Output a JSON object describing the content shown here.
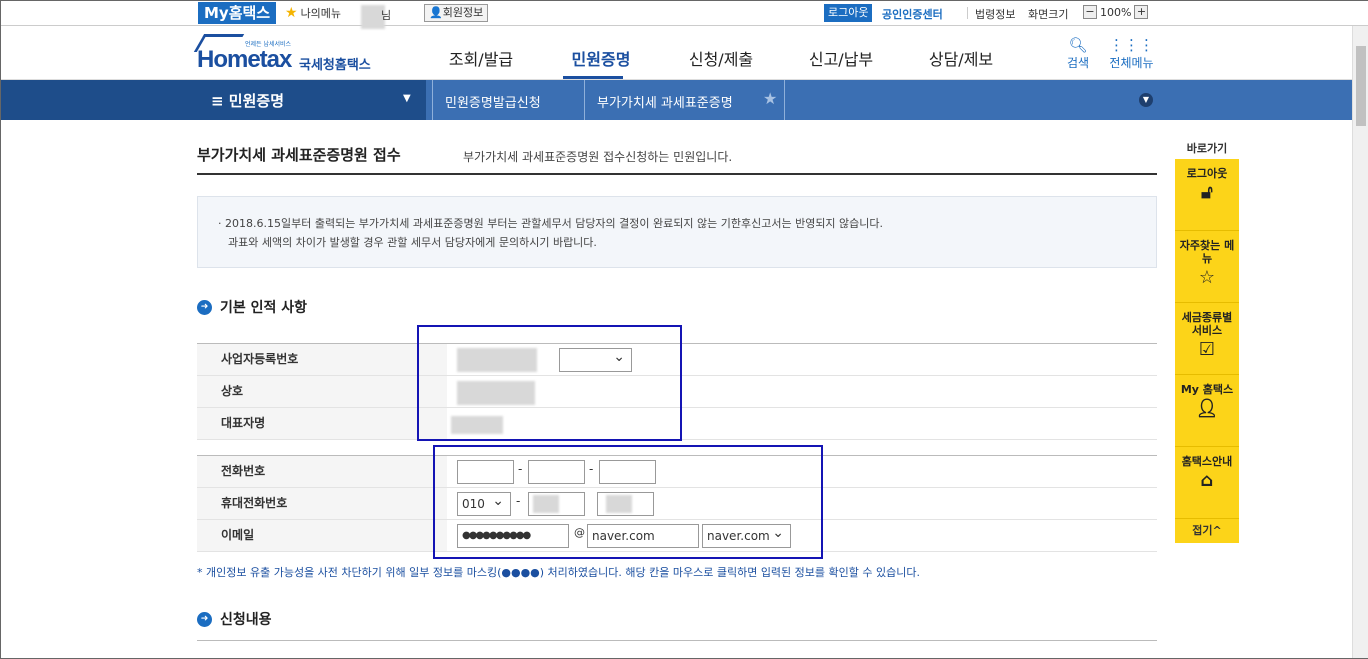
{
  "topbar": {
    "my_hometax": "My홈택스",
    "my_menu": "나의메뉴",
    "nim": "님",
    "member_info": "회원정보",
    "logout": "로그아웃",
    "cert_center": "공인인증센터",
    "law_info": "법령정보",
    "screen_size": "화면크기",
    "zoom_minus": "−",
    "zoom_level": "100%",
    "zoom_plus": "+"
  },
  "logo": {
    "tagline": "언제든 납세서비스",
    "home": "Hometax",
    "korean": "국세청홈택스"
  },
  "gnb": [
    "조회/발급",
    "민원증명",
    "신청/제출",
    "신고/납부",
    "상담/제보"
  ],
  "gnb_active": "민원증명",
  "header_tools": {
    "search": "검색",
    "all_menu": "전체메뉴"
  },
  "locbar": {
    "menu": "민원증명",
    "crumb1": "민원증명발급신청",
    "crumb2": "부가가치세 과세표준증명"
  },
  "page": {
    "title": "부가가치세 과세표준증명원 접수",
    "desc": "부가가치세 과세표준증명원 접수신청하는 민원입니다."
  },
  "notice": {
    "line1": "· 2018.6.15일부터 출력되는 부가가치세 과세표준증명원 부터는 관할세무서 담당자의 결정이 완료되지 않는 기한후신고서는 반영되지 않습니다.",
    "line2": "과표와 세액의 차이가 발생할 경우 관할 세무서 담당자에게 문의하시기 바랍니다."
  },
  "section1": {
    "title": "기본 인적 사항",
    "labels": {
      "biz_no": "사업자등록번호",
      "company": "상호",
      "ceo": "대표자명"
    }
  },
  "contact": {
    "labels": {
      "phone": "전화번호",
      "mobile": "휴대전화번호",
      "email": "이메일"
    },
    "mobile_prefix": "010",
    "email_id": "●●●●●●●●●●",
    "at": "@",
    "email_domain": "naver.com",
    "email_select": "naver.com",
    "dash": "-"
  },
  "privacy_note": "* 개인정보 유출 가능성을 사전 차단하기 위해 일부 정보를 마스킹(●●●●) 처리하였습니다. 해당 칸을 마우스로 클릭하면 입력된 정보를 확인할 수 있습니다.",
  "section2": {
    "title": "신청내용"
  },
  "quick": {
    "title": "바로가기",
    "items": [
      {
        "label": "로그아웃"
      },
      {
        "label": "자주찾는 메뉴"
      },
      {
        "label": "세금종류별 서비스"
      },
      {
        "label": "My 홈택스"
      },
      {
        "label": "홈택스안내"
      }
    ],
    "close": "접기^"
  },
  "colors": {
    "brand": "#1b6dc1",
    "navy": "#1e4d8a",
    "quick": "#fcd419",
    "highlight": "#1414b4"
  }
}
